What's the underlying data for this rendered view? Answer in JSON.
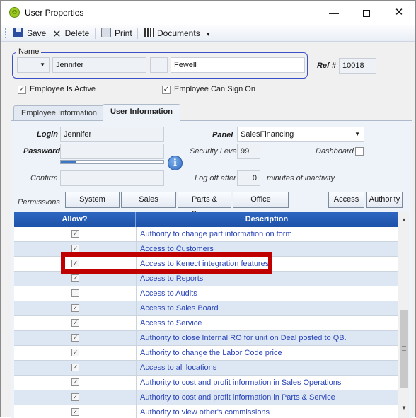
{
  "window": {
    "title": "User Properties",
    "minimize": "—",
    "close": "✕"
  },
  "toolbar": {
    "save": "Save",
    "delete": "Delete",
    "print": "Print",
    "documents": "Documents",
    "documents_caret": "▾",
    "delete_glyph": "✕"
  },
  "name_group": {
    "legend": "Name",
    "prefix_value": "",
    "first_name": "Jennifer",
    "middle_initial": "",
    "last_name": "Fewell"
  },
  "ref": {
    "label": "Ref #",
    "value": "10018"
  },
  "checks": {
    "employee_active": {
      "label": "Employee Is Active",
      "checked": true
    },
    "employee_sign_on": {
      "label": "Employee Can Sign On",
      "checked": true
    }
  },
  "tabs": [
    {
      "label": "Employee Information",
      "active": false
    },
    {
      "label": "User Information",
      "active": true
    }
  ],
  "user_info": {
    "login_label": "Login",
    "login_value": "Jennifer",
    "password_label": "Password",
    "password_value": "",
    "password_strength": 0.15,
    "confirm_label": "Confirm",
    "confirm_value": "",
    "panel_label": "Panel",
    "panel_value": "SalesFinancing",
    "security_label": "Security Level",
    "security_value": "99",
    "dashboard_label": "Dashboard",
    "dashboard_checked": false,
    "logoff_label": "Log off after",
    "logoff_value": "0",
    "logoff_suffix": "minutes of inactivity",
    "info_glyph": "i"
  },
  "permissions": {
    "label": "Permissions",
    "buttons": [
      "System",
      "Sales",
      "Parts & Service",
      "Office"
    ],
    "right_buttons": [
      "Access",
      "Authority"
    ]
  },
  "grid": {
    "columns": [
      "Allow?",
      "Description"
    ],
    "rows": [
      {
        "allow": true,
        "description": "Authority to change part information on form"
      },
      {
        "allow": true,
        "description": "Access to Customers"
      },
      {
        "allow": true,
        "description": "Access to Kenect integration features"
      },
      {
        "allow": true,
        "description": "Access to Reports"
      },
      {
        "allow": false,
        "description": "Access to Audits"
      },
      {
        "allow": true,
        "description": "Access to Sales Board"
      },
      {
        "allow": true,
        "description": "Access to Service"
      },
      {
        "allow": true,
        "description": "Authority to close Internal RO for unit on Deal posted to QB."
      },
      {
        "allow": true,
        "description": "Authority to change the Labor Code price"
      },
      {
        "allow": true,
        "description": "Access to all locations"
      },
      {
        "allow": true,
        "description": "Authority to cost and profit information in Sales Operations"
      },
      {
        "allow": true,
        "description": "Authority to cost and profit information in Parts & Service"
      },
      {
        "allow": true,
        "description": "Authority to view other's commissions"
      }
    ],
    "highlighted_row": 2,
    "check_glyph": "✓",
    "scroll_up": "▲",
    "scroll_down": "▼"
  },
  "colors": {
    "accent": "#1f52a8",
    "highlight": "#c00000",
    "row_alt": "#dde7f4",
    "link_text": "#2a45b8"
  }
}
